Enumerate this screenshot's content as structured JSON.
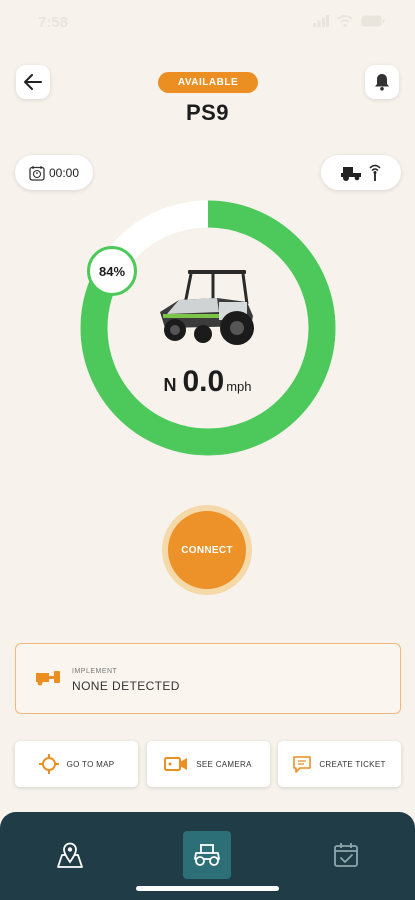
{
  "status_bar": {
    "time": "7:58"
  },
  "header": {
    "status_badge": "AVAILABLE",
    "vehicle_name": "PS9"
  },
  "timer": {
    "value": "00:00"
  },
  "gauge": {
    "battery_percent_label": "84%",
    "battery_level": 0.84,
    "direction": "N",
    "speed": "0.0",
    "speed_unit": "mph",
    "colors": {
      "fill": "#4cc95a",
      "track": "#ffffff"
    }
  },
  "connect": {
    "label": "CONNECT"
  },
  "implement": {
    "label": "IMPLEMENT",
    "value": "NONE DETECTED"
  },
  "actions": {
    "go_to_map": "GO TO MAP",
    "see_camera": "SEE CAMERA",
    "create_ticket": "CREATE TICKET"
  },
  "theme": {
    "accent": "#ec8f23",
    "nav_background": "#1f3c47",
    "nav_active": "#2d6f77"
  }
}
